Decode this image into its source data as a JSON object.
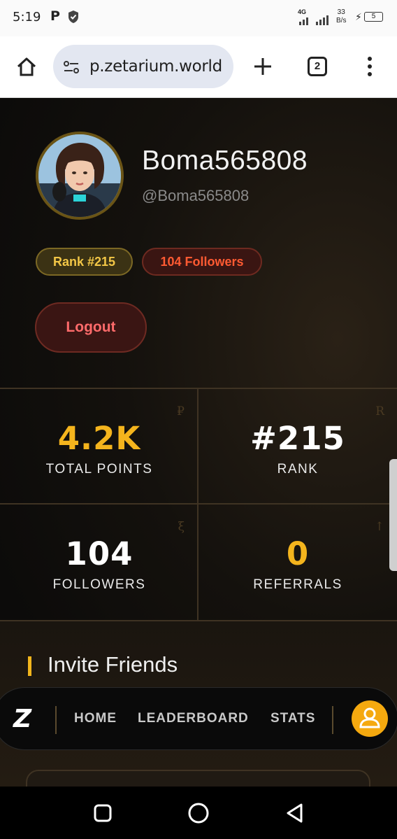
{
  "status_bar": {
    "time": "5:19",
    "network": "4G",
    "speed_value": "33",
    "speed_unit": "B/s",
    "battery": "5"
  },
  "browser": {
    "url": "p.zetarium.world",
    "tab_count": "2"
  },
  "profile": {
    "username": "Boma565808",
    "handle": "@Boma565808",
    "rank_badge": "Rank #215",
    "followers_badge": "104 Followers",
    "logout_label": "Logout"
  },
  "stats": [
    {
      "value": "4.2K",
      "label": "TOTAL POINTS",
      "corner": "₽",
      "color": "#f4b41d"
    },
    {
      "value": "#215",
      "label": "RANK",
      "corner": "R",
      "color": "#ffffff"
    },
    {
      "value": "104",
      "label": "FOLLOWERS",
      "corner": "ξ",
      "color": "#ffffff"
    },
    {
      "value": "0",
      "label": "REFERRALS",
      "corner": "↑",
      "color": "#f4b41d"
    }
  ],
  "invite": {
    "title": "Invite Friends"
  },
  "bottom_nav": {
    "logo": "Z",
    "items": [
      "HOME",
      "LEADERBOARD",
      "STATS"
    ]
  },
  "colors": {
    "accent_gold": "#f4b41d",
    "accent_red": "#ff5a32",
    "background": "#0d0c0b"
  }
}
